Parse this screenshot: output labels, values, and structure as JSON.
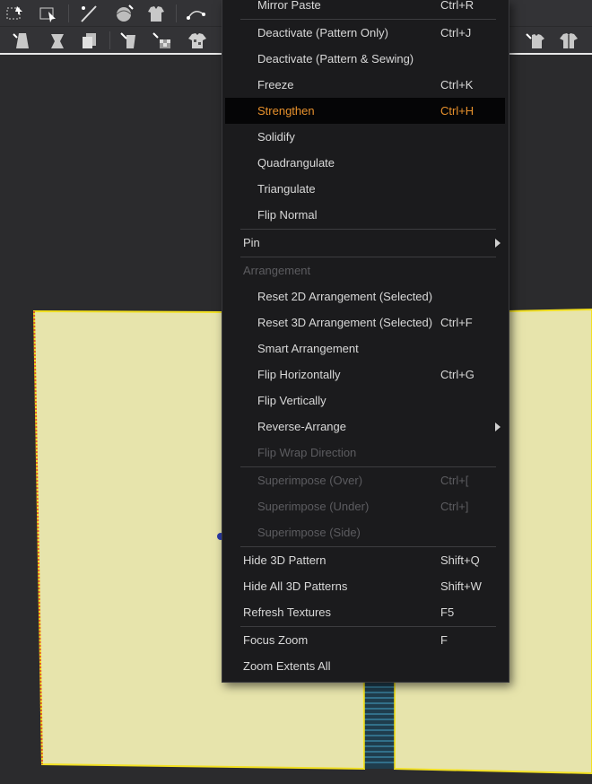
{
  "toolbar": {
    "row1_tools": [
      "select-transform-pattern-icon",
      "edit-pattern-icon",
      "needle-icon",
      "ball-icon",
      "garment-icon",
      "edit-curve-icon"
    ],
    "row2_tools": [
      "avatar-dress-icon",
      "garment-fold-icon",
      "fabric-copy-icon",
      "avatar-pin-icon",
      "arrange-points-icon",
      "shirt-pattern-icon",
      "tshirt-icon",
      "zip-shirt-icon"
    ]
  },
  "menu": {
    "items": [
      {
        "label": "Mirror Paste",
        "shortcut": "Ctrl+R",
        "indent": true
      },
      {
        "label": "Deactivate (Pattern Only)",
        "shortcut": "Ctrl+J",
        "indent": true
      },
      {
        "label": "Deactivate (Pattern & Sewing)",
        "shortcut": "",
        "indent": true
      },
      {
        "label": "Freeze",
        "shortcut": "Ctrl+K",
        "indent": true
      },
      {
        "label": "Strengthen",
        "shortcut": "Ctrl+H",
        "indent": true,
        "highlighted": true
      },
      {
        "label": "Solidify",
        "shortcut": "",
        "indent": true
      },
      {
        "label": "Quadrangulate",
        "shortcut": "",
        "indent": true
      },
      {
        "label": "Triangulate",
        "shortcut": "",
        "indent": true
      },
      {
        "label": "Flip Normal",
        "shortcut": "",
        "indent": true
      },
      {
        "label": "Pin",
        "shortcut": "",
        "indent": false,
        "submenu": true
      },
      {
        "label": "Arrangement",
        "shortcut": "",
        "indent": false,
        "disabled": true
      },
      {
        "label": "Reset 2D Arrangement (Selected)",
        "shortcut": "",
        "indent": true
      },
      {
        "label": "Reset 3D Arrangement (Selected)",
        "shortcut": "Ctrl+F",
        "indent": true
      },
      {
        "label": "Smart Arrangement",
        "shortcut": "",
        "indent": true
      },
      {
        "label": "Flip Horizontally",
        "shortcut": "Ctrl+G",
        "indent": true
      },
      {
        "label": "Flip Vertically",
        "shortcut": "",
        "indent": true
      },
      {
        "label": "Reverse-Arrange",
        "shortcut": "",
        "indent": true,
        "submenu": true
      },
      {
        "label": "Flip Wrap Direction",
        "shortcut": "",
        "indent": true,
        "disabled": true
      },
      {
        "label": "Superimpose (Over)",
        "shortcut": "Ctrl+[",
        "indent": true,
        "disabled": true
      },
      {
        "label": "Superimpose (Under)",
        "shortcut": "Ctrl+]",
        "indent": true,
        "disabled": true
      },
      {
        "label": "Superimpose (Side)",
        "shortcut": "",
        "indent": true,
        "disabled": true
      },
      {
        "label": "Hide 3D Pattern",
        "shortcut": "Shift+Q",
        "indent": false
      },
      {
        "label": "Hide All 3D Patterns",
        "shortcut": "Shift+W",
        "indent": false
      },
      {
        "label": "Refresh Textures",
        "shortcut": "F5",
        "indent": false
      },
      {
        "label": "Focus Zoom",
        "shortcut": "F",
        "indent": false
      },
      {
        "label": "Zoom Extents All",
        "shortcut": "",
        "indent": false
      }
    ]
  },
  "colors": {
    "pattern_fill": "#e7e4ac",
    "pattern_outline": "#f2e021",
    "highlight_text": "#e8912c",
    "sewing_strip": "#3f8fb0"
  }
}
